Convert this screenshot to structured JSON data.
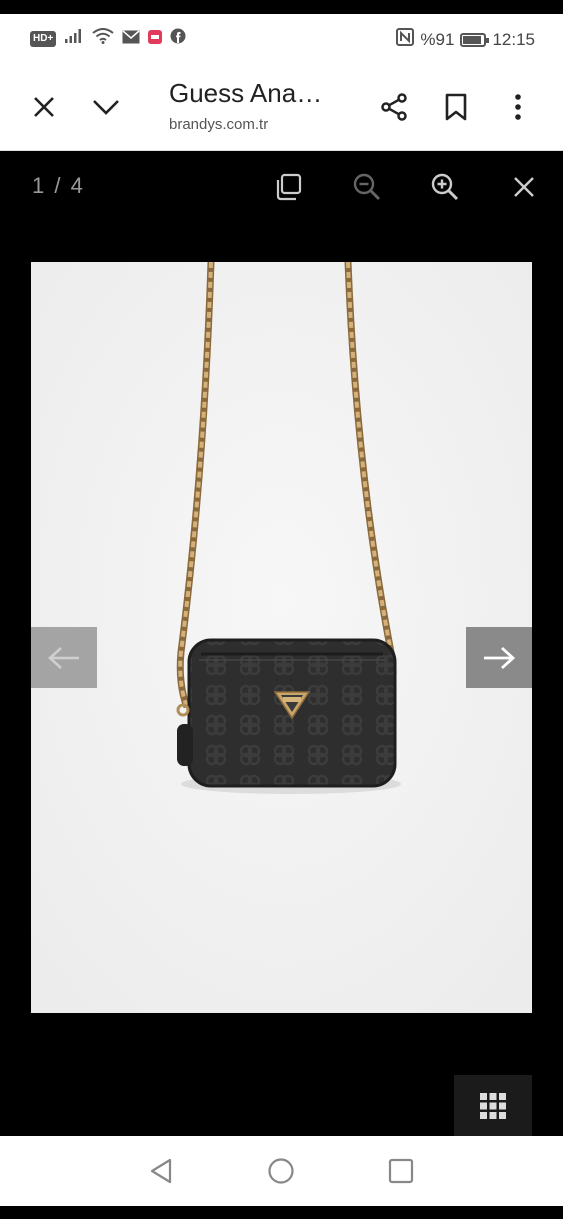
{
  "status_bar": {
    "hd_label": "HD+",
    "battery_text": "%91",
    "battery_level_percent": 91,
    "time": "12:15",
    "icons": [
      "signal-icon",
      "wifi-icon",
      "mail-icon",
      "app-notification-icon",
      "facebook-icon",
      "nfc-icon",
      "battery-icon"
    ]
  },
  "app_bar": {
    "title": "Guess Ana…",
    "url": "brandys.com.tr",
    "icons": [
      "close-icon",
      "chevron-down-icon",
      "share-icon",
      "bookmark-icon",
      "more-vertical-icon"
    ]
  },
  "viewer": {
    "counter": "1 / 4",
    "icons": [
      "copy-icon",
      "zoom-out-icon",
      "zoom-in-icon",
      "close-icon",
      "arrow-left-icon",
      "arrow-right-icon",
      "grid-icon"
    ]
  },
  "system_nav": {
    "icons": [
      "back-triangle-icon",
      "home-circle-icon",
      "recents-square-icon"
    ]
  },
  "colors": {
    "app_bar_bg": "#ffffff",
    "viewer_bg": "#000000",
    "photo_bg": "#f0f0f0",
    "bag_body": "#2f2f2f",
    "chain_gold": "#b8935a"
  }
}
